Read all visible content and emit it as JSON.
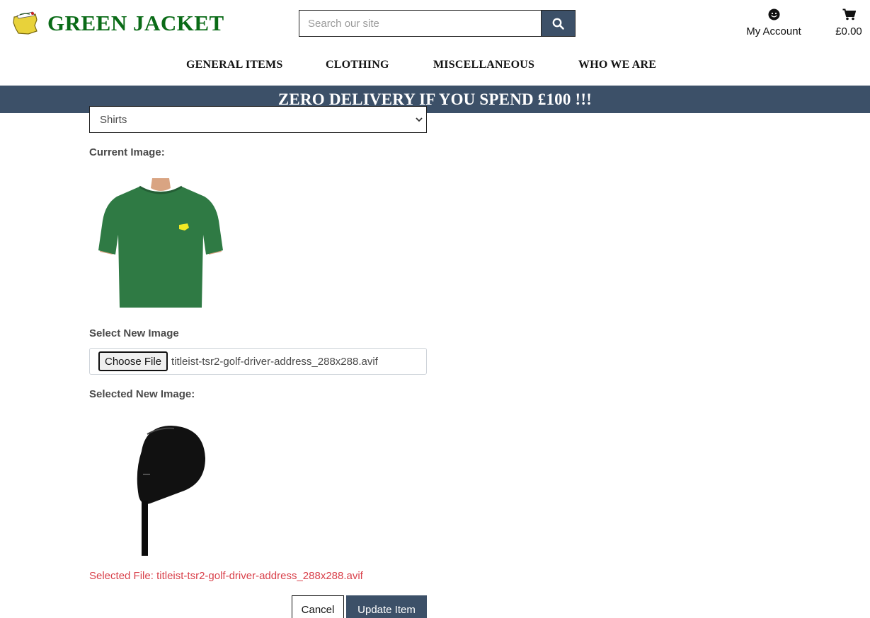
{
  "brand": {
    "name": "GREEN JACKET",
    "logo_icon": "masters-logo-icon",
    "brand_color": "#0a6b17"
  },
  "search": {
    "placeholder": "Search our site",
    "icon": "search-icon"
  },
  "account": {
    "label": "My Account",
    "icon": "smiley-user-icon"
  },
  "bag": {
    "total": "£0.00",
    "icon": "cart-icon"
  },
  "nav": {
    "items": [
      "GENERAL ITEMS",
      "CLOTHING",
      "MISCELLANEOUS",
      "WHO WE ARE"
    ]
  },
  "banner": {
    "text": "ZERO DELIVERY IF YOU SPEND £100 !!!",
    "color": "#3c5068"
  },
  "form": {
    "category_selected": "Shirts",
    "current_image_label": "Current Image:",
    "current_image_alt": "green-tshirt-image",
    "select_new_image_label": "Select New Image",
    "choose_file_label": "Choose File",
    "chosen_file_name": "titleist-tsr2-golf-driver-address_288x288.avif",
    "selected_new_image_label": "Selected New Image:",
    "selected_file_prefix": "Selected File:",
    "selected_file_name": "titleist-tsr2-golf-driver-address_288x288.avif",
    "cancel_label": "Cancel",
    "update_label": "Update Item"
  },
  "colors": {
    "accent": "#3c5068",
    "error": "#d9414b",
    "text": "#4a4a4a"
  }
}
